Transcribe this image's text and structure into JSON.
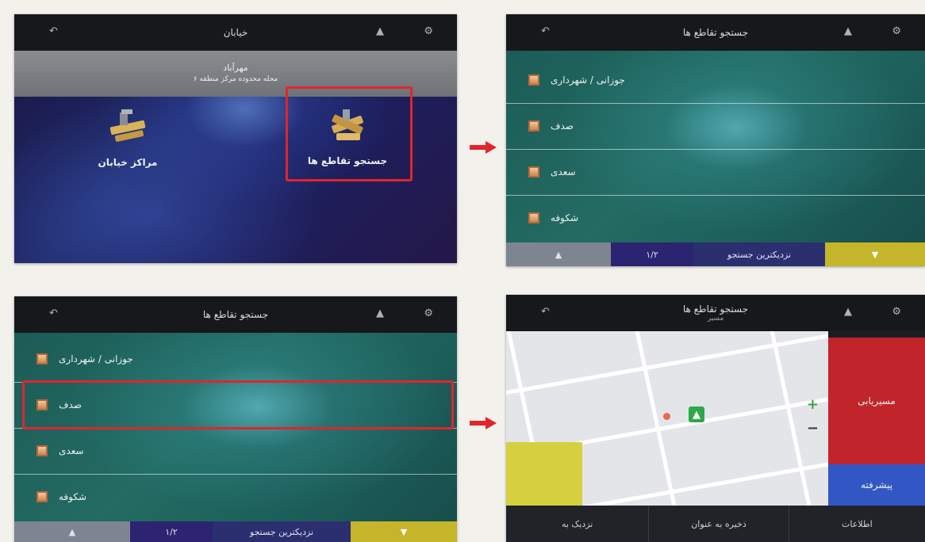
{
  "panel1": {
    "title": "خیابان",
    "icons": {
      "back": "back-arrow-icon",
      "t1": "chevron-up-icon",
      "t2": "settings-icon"
    },
    "sub_title": "مهرآباد",
    "sub_subtitle": "محله محدوده مرکز منطقه ۶",
    "left_item": "مراکز خیابان",
    "right_item": "جستجو تقاطع ها"
  },
  "panel2": {
    "title": "جستجو تقاطع ها",
    "rows": [
      "جوزانی / شهرداری",
      "صدف",
      "سعدی",
      "شکوفه"
    ],
    "bottom": {
      "left": "▲",
      "page": "۱/۲",
      "nearest": "نزدیکترین جستجو",
      "right": "▼"
    }
  },
  "panel3": {
    "title": "جستجو تقاطع ها",
    "rows": [
      "جوزانی / شهرداری",
      "صدف",
      "سعدی",
      "شکوفه"
    ],
    "bottom": {
      "left": "▲",
      "page": "۱/۲",
      "nearest": "نزدیکترین جستجو",
      "right": "▼"
    }
  },
  "panel4": {
    "title": "جستجو تقاطع ها",
    "subtitle": "مسیر",
    "zoom_in": "+",
    "zoom_out": "−",
    "side_top": "مسیریابی",
    "side_bottom": "پیشرفته",
    "bottom": [
      "نزدیک به",
      "ذخیره به عنوان",
      "اطلاعات"
    ]
  },
  "colors": {
    "highlight": "#e2242b",
    "arrow": "#e2242b",
    "yellow_button": "#c4b52a",
    "route_red": "#c2242c",
    "advanced_blue": "#3256c4"
  }
}
